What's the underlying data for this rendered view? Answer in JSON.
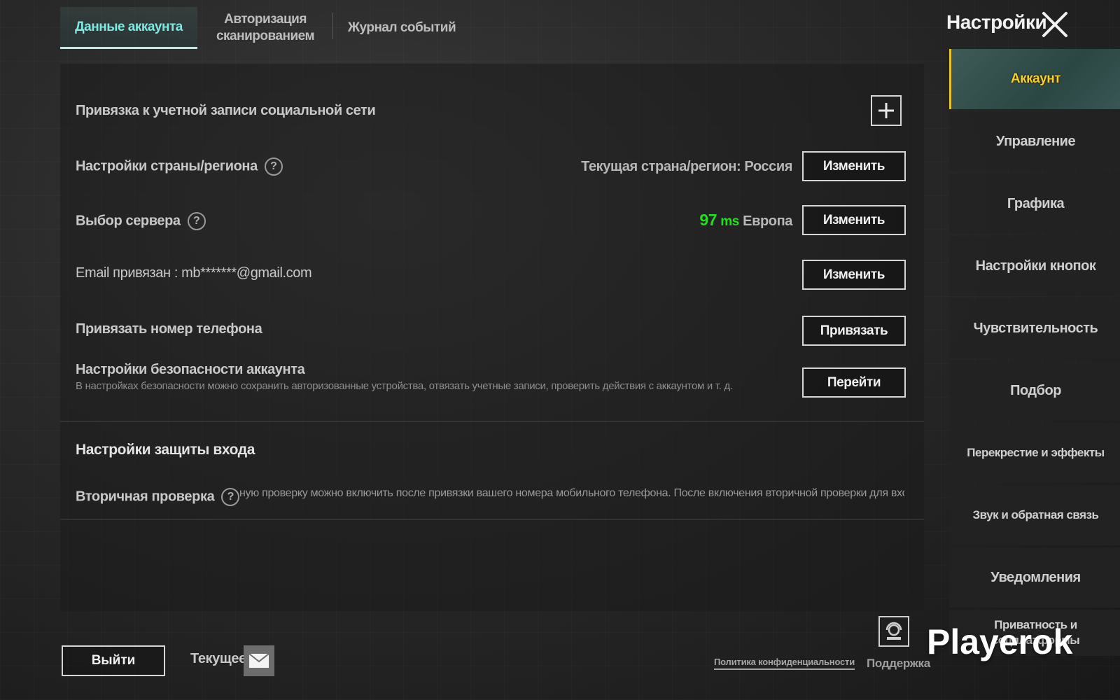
{
  "header": {
    "tabs": [
      {
        "label": "Данные аккаунта"
      },
      {
        "label": "Авторизация сканированием"
      },
      {
        "label": "Журнал событий"
      }
    ],
    "title": "Настройки"
  },
  "rows": {
    "social": {
      "label": "Привязка к учетной записи социальной сети"
    },
    "region": {
      "label": "Настройки страны/региона",
      "info": "Текущая страна/регион: Россия",
      "button": "Изменить"
    },
    "server": {
      "label": "Выбор сервера",
      "ping": "97",
      "ping_unit": "ms",
      "region": "Европа",
      "button": "Изменить"
    },
    "email": {
      "label": "Email привязан : mb*******@gmail.com",
      "button": "Изменить"
    },
    "phone": {
      "label": "Привязать номер телефона",
      "button": "Привязать"
    },
    "security": {
      "label": "Настройки безопасности аккаунта",
      "note": "В настройках безопасности можно сохранить авторизованные устройства, отвязать учетные записи, проверить действия с аккаунтом и т. д.",
      "button": "Перейти"
    }
  },
  "login_protection": {
    "title": "Настройки защиты входа",
    "secondary_label": "Вторичная проверка",
    "secondary_text": "ную проверку можно включить после привязки вашего номера мобильного телефона. После включения вторичной проверки для вход"
  },
  "sidebar": {
    "items": [
      {
        "label": "Аккаунт"
      },
      {
        "label": "Управление"
      },
      {
        "label": "Графика"
      },
      {
        "label": "Настройки кнопок"
      },
      {
        "label": "Чувствительность"
      },
      {
        "label": "Подбор"
      },
      {
        "label": "Перекрестие и эффекты"
      },
      {
        "label": "Звук и обратная связь"
      },
      {
        "label": "Уведомления"
      },
      {
        "label": "Приватность и соцплатформы"
      }
    ]
  },
  "footer": {
    "exit": "Выйти",
    "current": "Текущее",
    "policy": "Политика конфиденциальности",
    "support": "Поддержка",
    "watermark": "Playerok"
  },
  "colors": {
    "accent_tab": "#7fe8e0",
    "ping_green": "#22dd22",
    "active_sidebar_text": "#f1d12a"
  }
}
